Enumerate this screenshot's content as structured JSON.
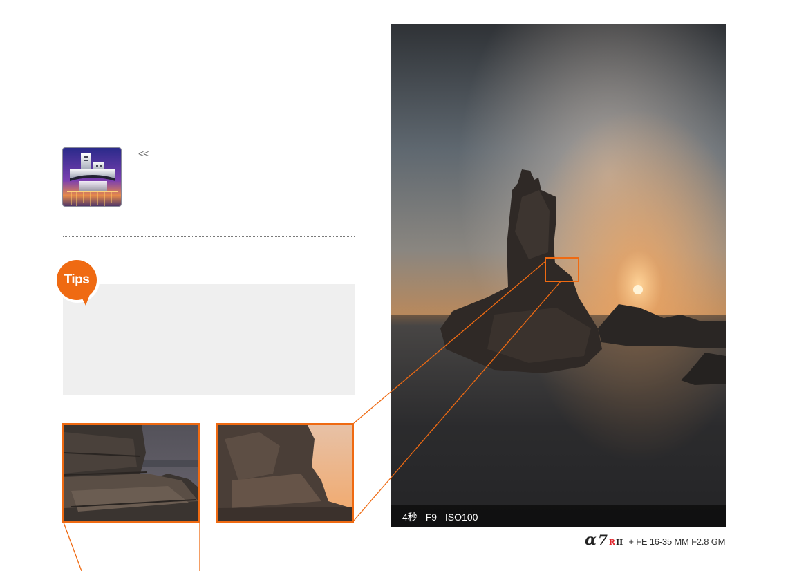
{
  "scene_icon": {
    "icon": "night-scene-building-icon"
  },
  "back_icon": {
    "glyph": "<<",
    "icon": "double-chevron-left-icon"
  },
  "tips": {
    "badge_label": "Tips",
    "badge_color": "#ef6a12"
  },
  "main_photo": {
    "exif": {
      "shutter": "4秒",
      "aperture": "F9",
      "iso": "ISO100"
    }
  },
  "camera_caption": {
    "alpha": "α",
    "model": "7",
    "model_r": "R",
    "model_ii": "II",
    "lens": "+ FE 16-35 MM F2.8 GM"
  },
  "colors": {
    "accent": "#ef6a12",
    "tips_box": "#efefef"
  }
}
